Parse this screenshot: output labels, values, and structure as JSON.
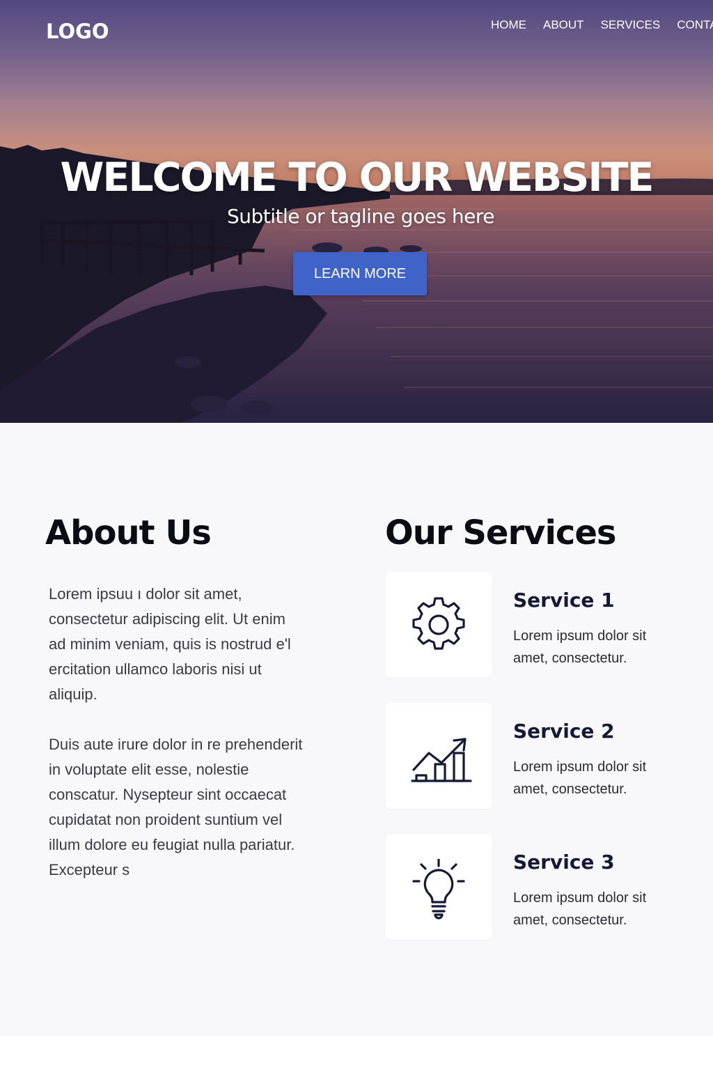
{
  "header": {
    "logo": "LOGO",
    "nav": [
      "HOME",
      "ABOUT",
      "SERVICES",
      "CONTA"
    ]
  },
  "hero": {
    "title": "WELCOME TO OUR WEBSITE",
    "subtitle": "Subtitle or tagline goes here",
    "cta_label": "LEARN MORE"
  },
  "about": {
    "heading": "About Us",
    "paragraphs": [
      "Lorem ipsuu ı dolor sit amet, consectetur adipiscing elit. Ut enim ad minim veniam, quis is nostrud e'l ercitation ullamco laboris nisi ut aliquip.",
      "Duis aute irure dolor in re prehenderit in voluptate elit esse, nolestie conscatur. Nysepteur sint occaecat cupidatat non proident suntium vel illum dolore eu feugiat nulla pariatur. Excepteur s"
    ]
  },
  "services": {
    "heading": "Our Services",
    "items": [
      {
        "title": "Service 1",
        "description": "Lorem ipsum dolor sit amet, consectetur.",
        "icon": "gear-icon"
      },
      {
        "title": "Service 2",
        "description": "Lorem ipsum dolor sit amet, consectetur.",
        "icon": "growth-chart-icon"
      },
      {
        "title": "Service 3",
        "description": "Lorem ipsum dolor sit amet, consectetur.",
        "icon": "lightbulb-icon"
      }
    ]
  },
  "colors": {
    "accent": "#3f63c8",
    "icon_stroke": "#141a36",
    "heading": "#0b0b14",
    "body_text": "#3a3a44",
    "section_bg": "#f8f8fa"
  }
}
